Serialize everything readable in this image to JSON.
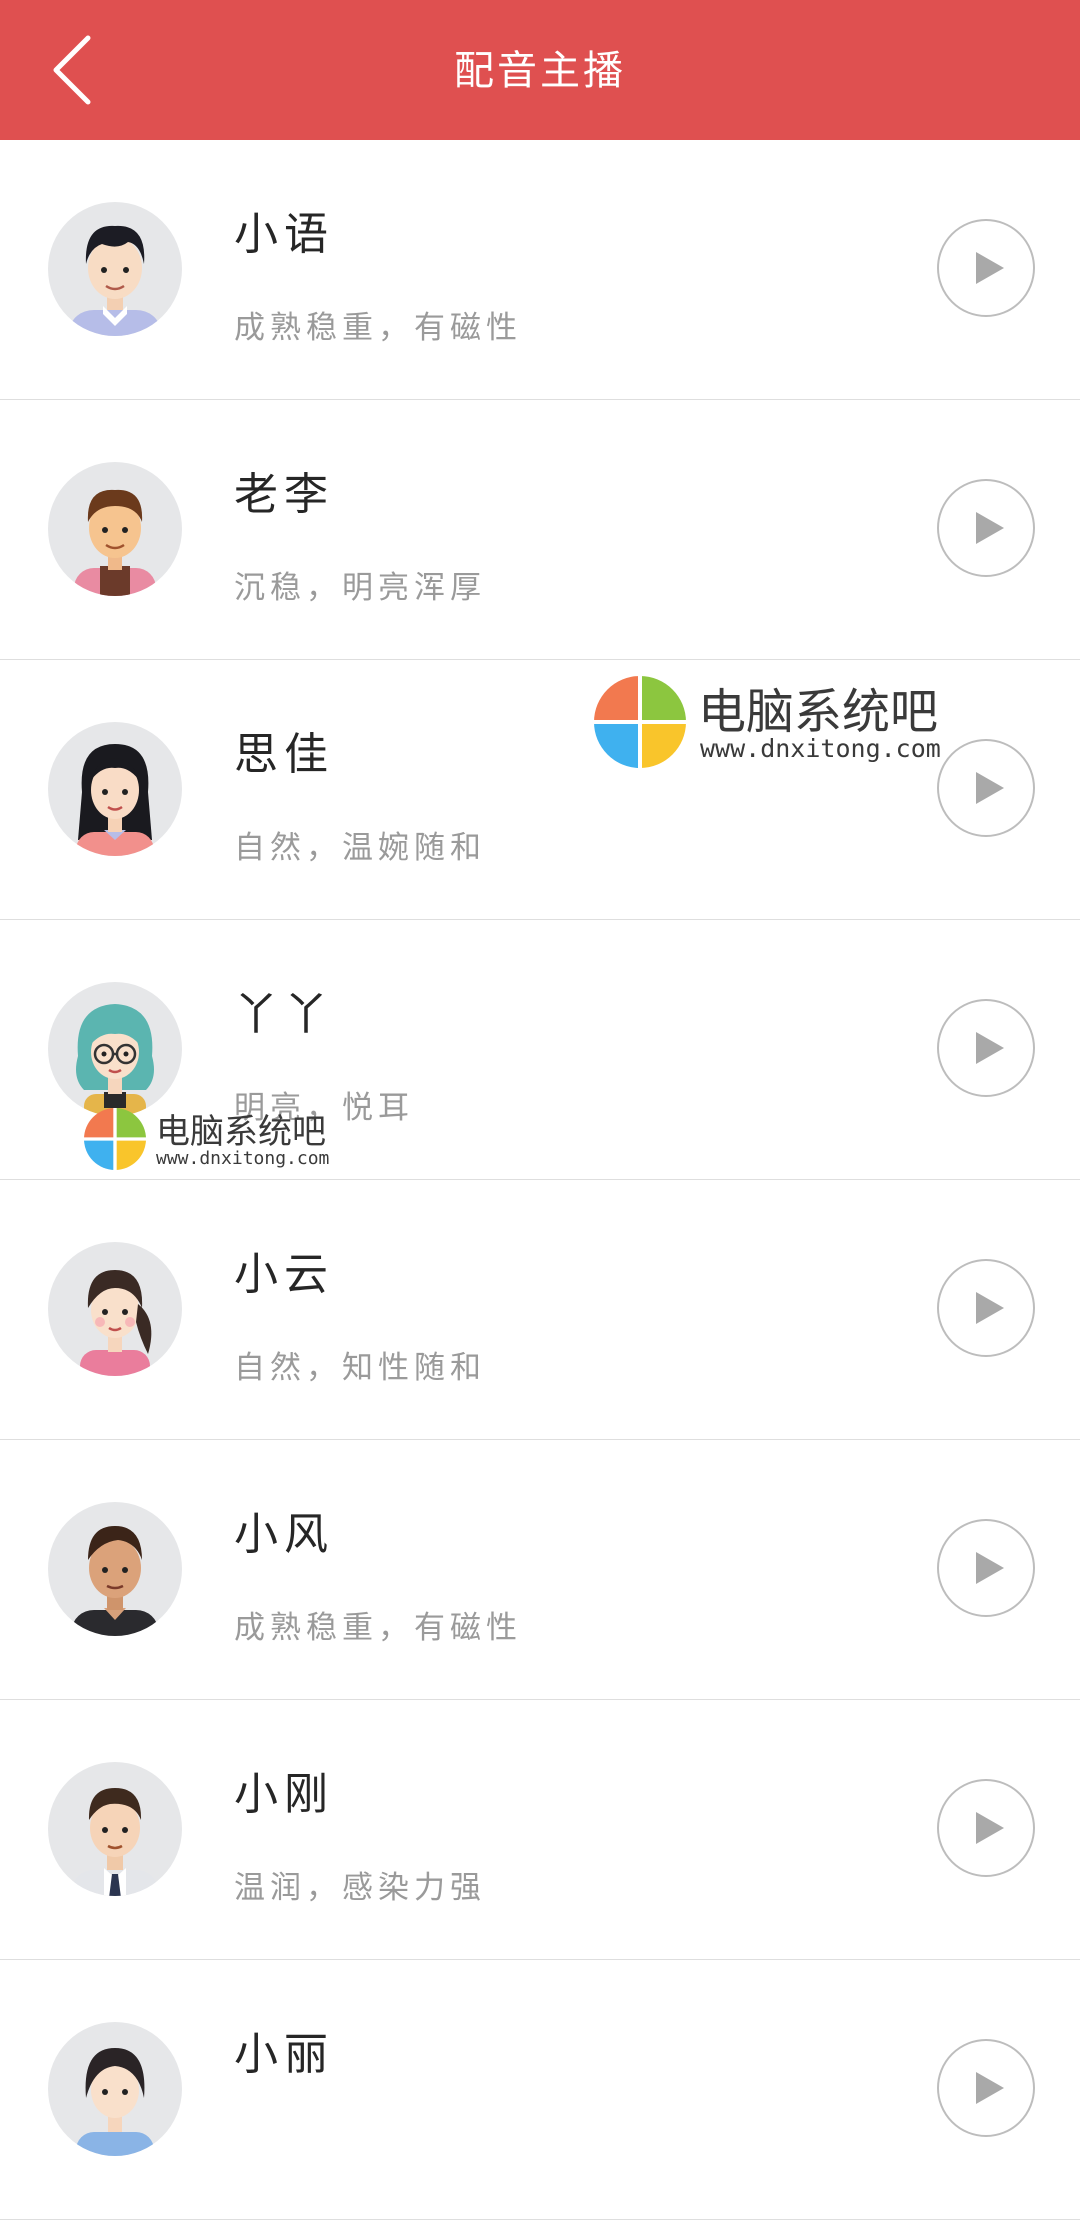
{
  "header": {
    "title": "配音主播",
    "back_icon": "chevron-left-icon",
    "background_color": "#df5050"
  },
  "anchors": [
    {
      "name": "小语",
      "description": "成熟稳重，有磁性",
      "avatar": "male-curly-hair-shirt"
    },
    {
      "name": "老李",
      "description": "沉稳，明亮浑厚",
      "avatar": "male-brown-hair-vest"
    },
    {
      "name": "思佳",
      "description": "自然，温婉随和",
      "avatar": "female-long-black-hair"
    },
    {
      "name": "丫丫",
      "description": "明亮，悦耳",
      "avatar": "female-teal-hair-glasses"
    },
    {
      "name": "小云",
      "description": "自然，知性随和",
      "avatar": "female-side-ponytail"
    },
    {
      "name": "小风",
      "description": "成熟稳重，有磁性",
      "avatar": "male-dark-skin"
    },
    {
      "name": "小刚",
      "description": "温润，感染力强",
      "avatar": "male-suit-tie"
    },
    {
      "name": "小丽",
      "description": "",
      "avatar": "female-short-hair"
    }
  ],
  "play_icon": "play-icon",
  "watermarks": [
    {
      "text": "电脑系统吧",
      "url": "www.dnxitong.com"
    },
    {
      "text": "电脑系统吧",
      "url": "www.dnxitong.com"
    }
  ]
}
